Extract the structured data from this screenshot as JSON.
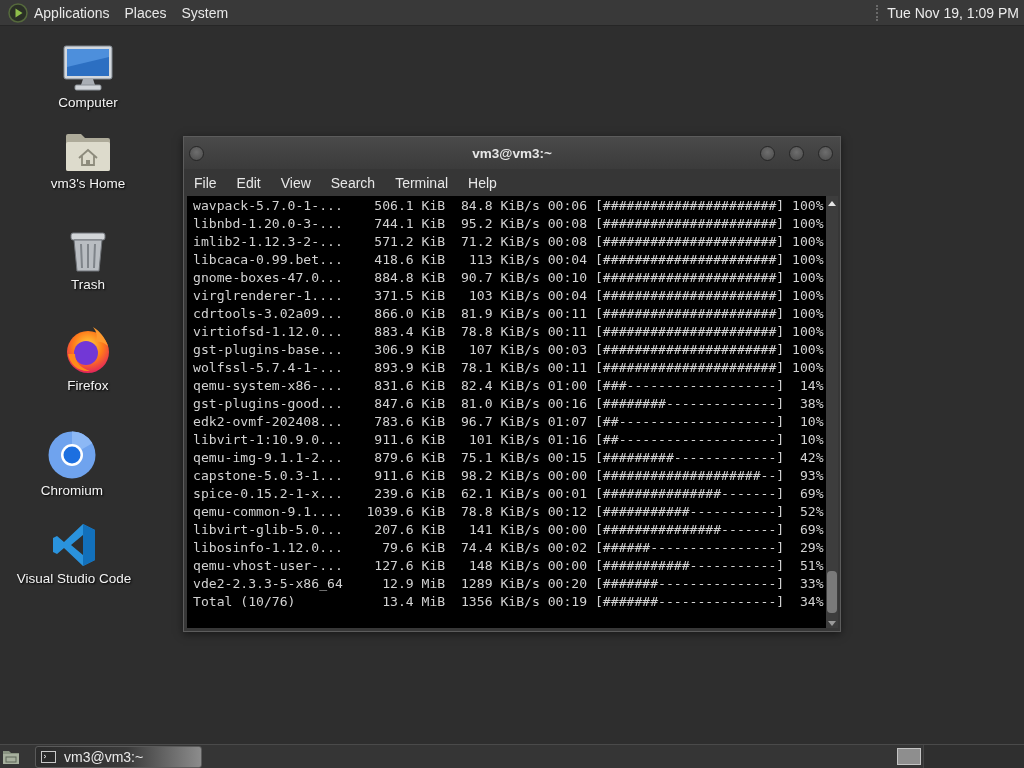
{
  "top_panel": {
    "menus": [
      "Applications",
      "Places",
      "System"
    ],
    "clock": "Tue Nov 19, 1:09 PM"
  },
  "desktop_icons": [
    {
      "kind": "computer",
      "label": "Computer"
    },
    {
      "kind": "home",
      "label": "vm3's Home"
    },
    {
      "kind": "trash",
      "label": "Trash"
    },
    {
      "kind": "firefox",
      "label": "Firefox"
    },
    {
      "kind": "chromium",
      "label": "Chromium"
    },
    {
      "kind": "vscode",
      "label": "Visual Studio Code"
    }
  ],
  "terminal": {
    "title": "vm3@vm3:~",
    "menu": [
      "File",
      "Edit",
      "View",
      "Search",
      "Terminal",
      "Help"
    ],
    "rows": [
      {
        "name": "wavpack-5.7.0-1-...",
        "size": "506.1 KiB",
        "speed": "84.8 KiB/s",
        "eta": "00:06",
        "bar": "[######################]",
        "percent": "100%"
      },
      {
        "name": "libnbd-1.20.0-3-...",
        "size": "744.1 KiB",
        "speed": "95.2 KiB/s",
        "eta": "00:08",
        "bar": "[######################]",
        "percent": "100%"
      },
      {
        "name": "imlib2-1.12.3-2-...",
        "size": "571.2 KiB",
        "speed": "71.2 KiB/s",
        "eta": "00:08",
        "bar": "[######################]",
        "percent": "100%"
      },
      {
        "name": "libcaca-0.99.bet...",
        "size": "418.6 KiB",
        "speed": "113 KiB/s",
        "eta": "00:04",
        "bar": "[######################]",
        "percent": "100%"
      },
      {
        "name": "gnome-boxes-47.0...",
        "size": "884.8 KiB",
        "speed": "90.7 KiB/s",
        "eta": "00:10",
        "bar": "[######################]",
        "percent": "100%"
      },
      {
        "name": "virglrenderer-1....",
        "size": "371.5 KiB",
        "speed": "103 KiB/s",
        "eta": "00:04",
        "bar": "[######################]",
        "percent": "100%"
      },
      {
        "name": "cdrtools-3.02a09...",
        "size": "866.0 KiB",
        "speed": "81.9 KiB/s",
        "eta": "00:11",
        "bar": "[######################]",
        "percent": "100%"
      },
      {
        "name": "virtiofsd-1.12.0...",
        "size": "883.4 KiB",
        "speed": "78.8 KiB/s",
        "eta": "00:11",
        "bar": "[######################]",
        "percent": "100%"
      },
      {
        "name": "gst-plugins-base...",
        "size": "306.9 KiB",
        "speed": "107 KiB/s",
        "eta": "00:03",
        "bar": "[######################]",
        "percent": "100%"
      },
      {
        "name": "wolfssl-5.7.4-1-...",
        "size": "893.9 KiB",
        "speed": "78.1 KiB/s",
        "eta": "00:11",
        "bar": "[######################]",
        "percent": "100%"
      },
      {
        "name": "qemu-system-x86-...",
        "size": "831.6 KiB",
        "speed": "82.4 KiB/s",
        "eta": "01:00",
        "bar": "[###-------------------]",
        "percent": "14%"
      },
      {
        "name": "gst-plugins-good...",
        "size": "847.6 KiB",
        "speed": "81.0 KiB/s",
        "eta": "00:16",
        "bar": "[########--------------]",
        "percent": "38%"
      },
      {
        "name": "edk2-ovmf-202408...",
        "size": "783.6 KiB",
        "speed": "96.7 KiB/s",
        "eta": "01:07",
        "bar": "[##--------------------]",
        "percent": "10%"
      },
      {
        "name": "libvirt-1:10.9.0...",
        "size": "911.6 KiB",
        "speed": "101 KiB/s",
        "eta": "01:16",
        "bar": "[##--------------------]",
        "percent": "10%"
      },
      {
        "name": "qemu-img-9.1.1-2...",
        "size": "879.6 KiB",
        "speed": "75.1 KiB/s",
        "eta": "00:15",
        "bar": "[#########-------------]",
        "percent": "42%"
      },
      {
        "name": "capstone-5.0.3-1...",
        "size": "911.6 KiB",
        "speed": "98.2 KiB/s",
        "eta": "00:00",
        "bar": "[####################--]",
        "percent": "93%"
      },
      {
        "name": "spice-0.15.2-1-x...",
        "size": "239.6 KiB",
        "speed": "62.1 KiB/s",
        "eta": "00:01",
        "bar": "[###############-------]",
        "percent": "69%"
      },
      {
        "name": "qemu-common-9.1....",
        "size": "1039.6 KiB",
        "speed": "78.8 KiB/s",
        "eta": "00:12",
        "bar": "[###########-----------]",
        "percent": "52%"
      },
      {
        "name": "libvirt-glib-5.0...",
        "size": "207.6 KiB",
        "speed": "141 KiB/s",
        "eta": "00:00",
        "bar": "[###############-------]",
        "percent": "69%"
      },
      {
        "name": "libosinfo-1.12.0...",
        "size": "79.6 KiB",
        "speed": "74.4 KiB/s",
        "eta": "00:02",
        "bar": "[######----------------]",
        "percent": "29%"
      },
      {
        "name": "qemu-vhost-user-...",
        "size": "127.6 KiB",
        "speed": "148 KiB/s",
        "eta": "00:00",
        "bar": "[###########-----------]",
        "percent": "51%"
      },
      {
        "name": "vde2-2.3.3-5-x86_64",
        "size": "12.9 MiB",
        "speed": "1289 KiB/s",
        "eta": "00:20",
        "bar": "[#######---------------]",
        "percent": "33%"
      },
      {
        "name": "Total (10/76)",
        "size": "13.4 MiB",
        "speed": "1356 KiB/s",
        "eta": "00:19",
        "bar": "[#######---------------]",
        "percent": "34%"
      }
    ]
  },
  "taskbar": {
    "tasks": [
      {
        "title": "vm3@vm3:~"
      }
    ]
  }
}
